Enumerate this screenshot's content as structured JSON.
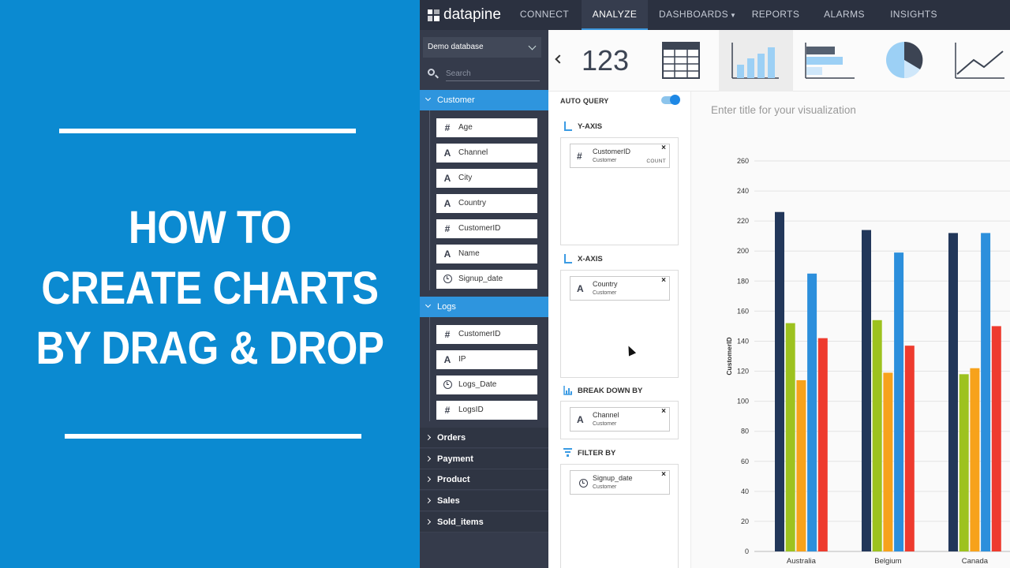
{
  "promo": {
    "line1": "HOW TO",
    "line2": "CREATE CHARTS",
    "line3": "BY DRAG & DROP",
    "background": "#0b8ad1"
  },
  "nav": {
    "logo": "datapine",
    "items": [
      "CONNECT",
      "ANALYZE",
      "DASHBOARDS",
      "REPORTS",
      "ALARMS",
      "INSIGHTS"
    ],
    "active": "ANALYZE"
  },
  "sidebar": {
    "database": "Demo database",
    "search_placeholder": "Search",
    "groups": [
      {
        "name": "Customer",
        "open": true,
        "fields": [
          {
            "type": "#",
            "name": "Age"
          },
          {
            "type": "A",
            "name": "Channel"
          },
          {
            "type": "A",
            "name": "City"
          },
          {
            "type": "A",
            "name": "Country"
          },
          {
            "type": "#",
            "name": "CustomerID"
          },
          {
            "type": "A",
            "name": "Name"
          },
          {
            "type": "clock",
            "name": "Signup_date"
          }
        ]
      },
      {
        "name": "Logs",
        "open": true,
        "fields": [
          {
            "type": "#",
            "name": "CustomerID"
          },
          {
            "type": "A",
            "name": "IP"
          },
          {
            "type": "clock",
            "name": "Logs_Date"
          },
          {
            "type": "#",
            "name": "LogsID"
          }
        ]
      },
      {
        "name": "Orders",
        "open": false
      },
      {
        "name": "Payment",
        "open": false
      },
      {
        "name": "Product",
        "open": false
      },
      {
        "name": "Sales",
        "open": false
      },
      {
        "name": "Sold_items",
        "open": false
      }
    ]
  },
  "chart_types": {
    "number_label": "123",
    "icons": [
      "number-chart-icon",
      "table-chart-icon",
      "bar-chart-icon",
      "horizontal-bar-chart-icon",
      "pie-chart-icon",
      "line-chart-icon"
    ],
    "selected": "bar-chart-icon"
  },
  "query": {
    "auto_query": "AUTO QUERY",
    "y_axis": {
      "label": "Y-AXIS",
      "pill": {
        "name": "CustomerID",
        "table": "Customer",
        "agg": "COUNT"
      }
    },
    "x_axis": {
      "label": "X-AXIS",
      "pill": {
        "name": "Country",
        "table": "Customer"
      }
    },
    "break_down": {
      "label": "BREAK DOWN BY",
      "pill": {
        "name": "Channel",
        "table": "Customer"
      }
    },
    "filter": {
      "label": "FILTER BY",
      "pill": {
        "name": "Signup_date",
        "table": "Customer"
      }
    }
  },
  "visualization": {
    "title_placeholder": "Enter title for your visualization"
  },
  "chart_data": {
    "type": "bar",
    "title": "",
    "xlabel": "",
    "ylabel": "CustomerID",
    "ylim": [
      0,
      260
    ],
    "yticks": [
      0,
      20,
      40,
      60,
      80,
      100,
      120,
      140,
      160,
      180,
      200,
      220,
      240,
      260
    ],
    "categories": [
      "Australia",
      "Belgium",
      "Canada"
    ],
    "series": [
      {
        "color": "#22375a",
        "values": [
          226,
          214,
          212
        ]
      },
      {
        "color": "#9dc21f",
        "values": [
          152,
          154,
          118
        ]
      },
      {
        "color": "#f7a21b",
        "values": [
          114,
          119,
          122
        ]
      },
      {
        "color": "#2c8fdc",
        "values": [
          185,
          199,
          212
        ]
      },
      {
        "color": "#ee3b2e",
        "values": [
          142,
          137,
          150
        ]
      }
    ],
    "grid": true
  }
}
